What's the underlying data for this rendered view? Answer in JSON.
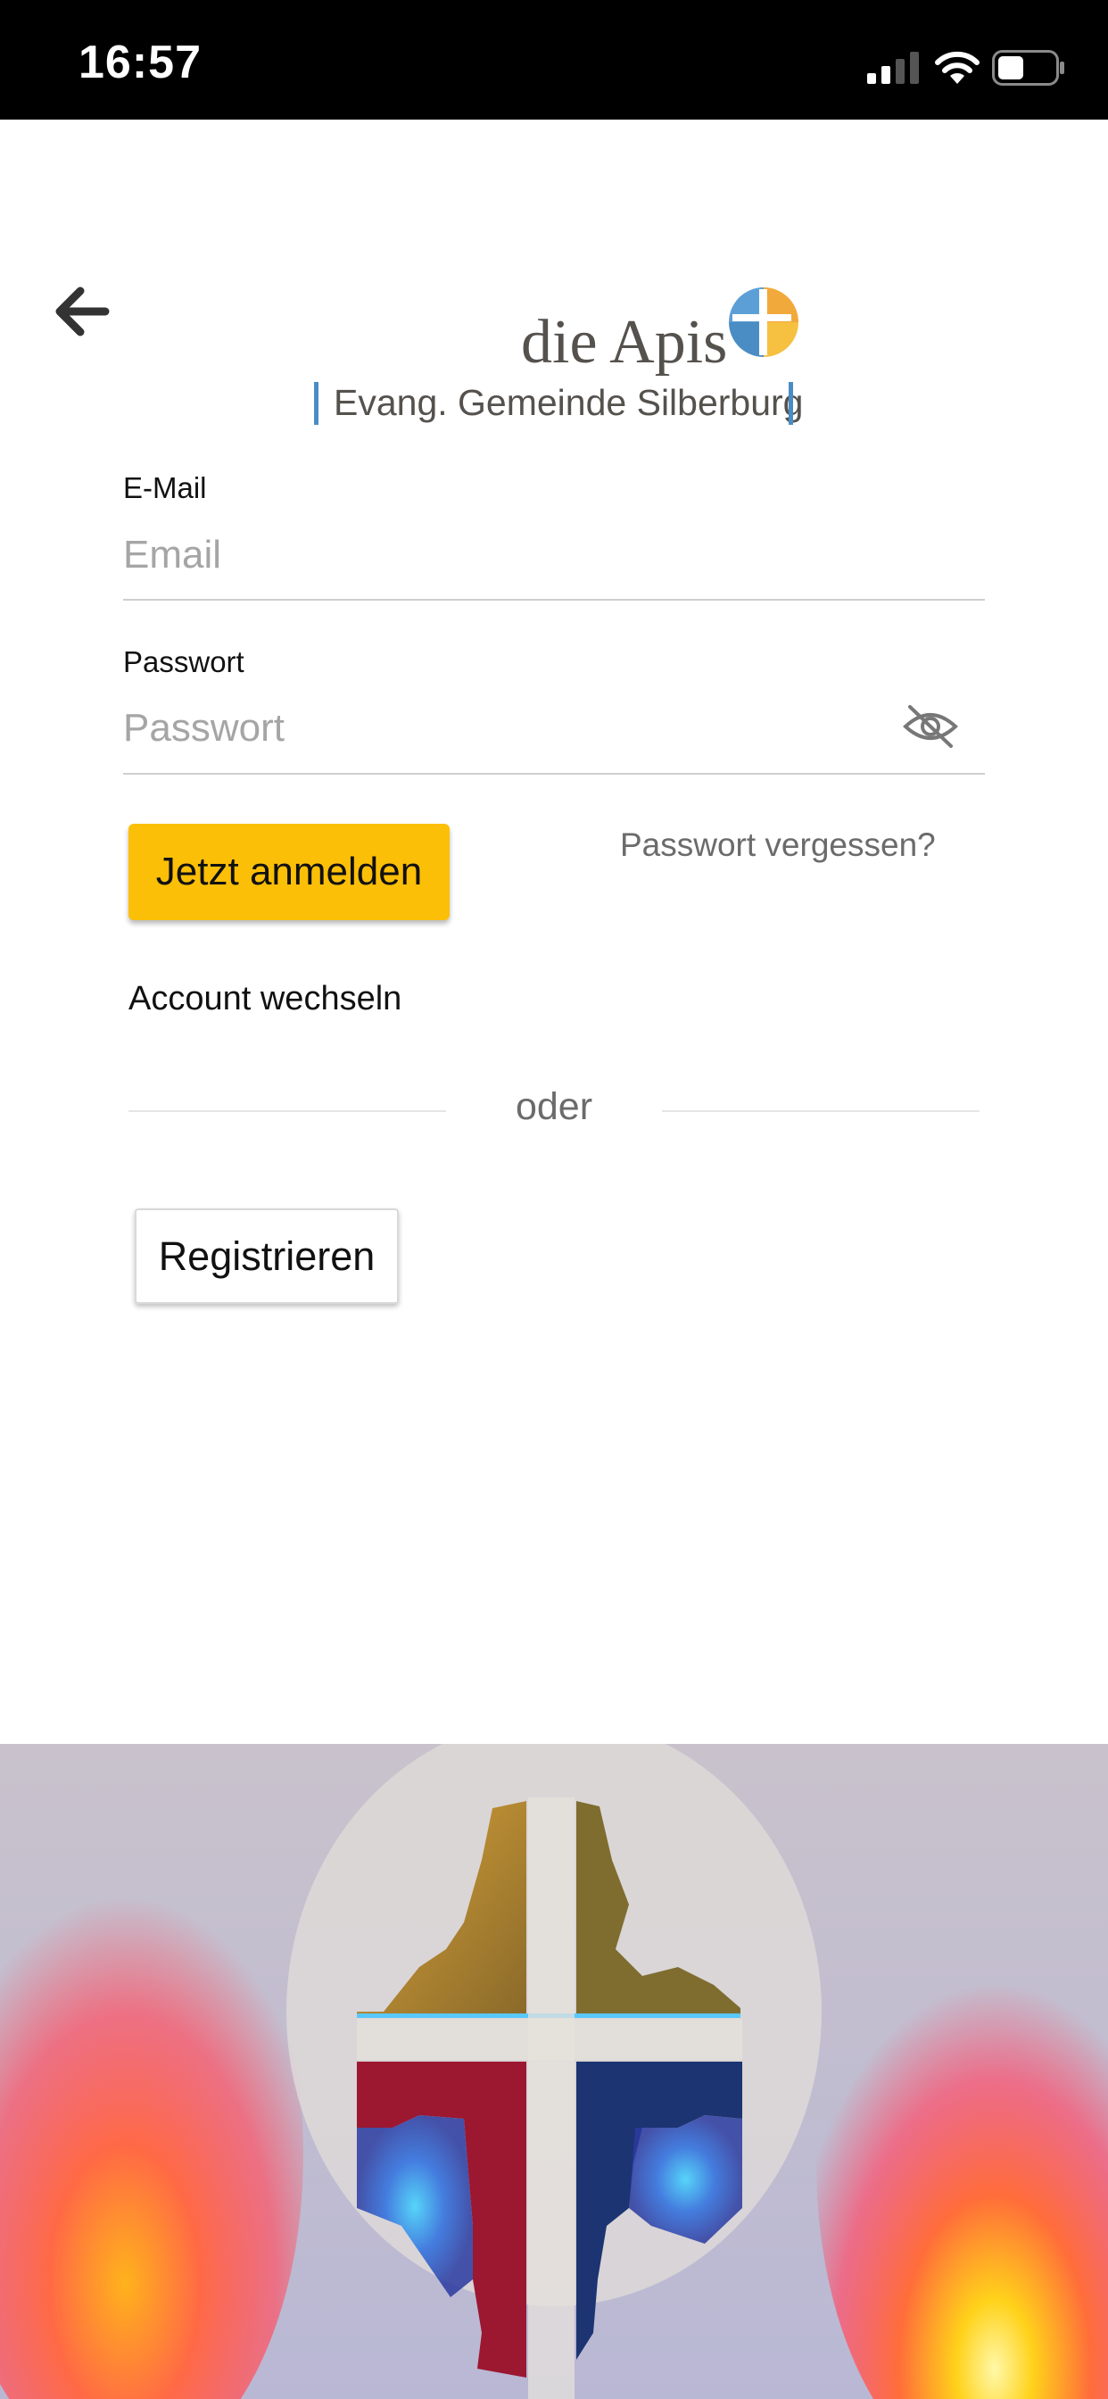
{
  "status_bar": {
    "time": "16:57",
    "icons": [
      "cellular-signal-icon",
      "wifi-icon",
      "battery-icon"
    ]
  },
  "header": {
    "back_icon": "arrow-left-icon"
  },
  "logo": {
    "name": "die Apis",
    "subtitle": "Evang. Gemeinde Silberburg",
    "colors": {
      "text": "#55514d",
      "accent_blue": "#4a8dc4",
      "accent_orange": "#f2a93b"
    }
  },
  "form": {
    "email": {
      "label": "E-Mail",
      "placeholder": "Email",
      "value": ""
    },
    "password": {
      "label": "Passwort",
      "placeholder": "Passwort",
      "value": "",
      "toggle_icon": "eye-slash-icon"
    },
    "login_label": "Jetzt anmelden",
    "forgot_label": "Passwort vergessen?",
    "switch_account_label": "Account wechseln",
    "divider_label": "oder",
    "register_label": "Registrieren"
  },
  "colors": {
    "primary_button": "#fcbf07",
    "status_bar": "#000000",
    "muted_text": "#6b6b6b",
    "placeholder": "#a5a5a5"
  },
  "hero": {
    "image": "illuminated-cross-sculpture"
  }
}
